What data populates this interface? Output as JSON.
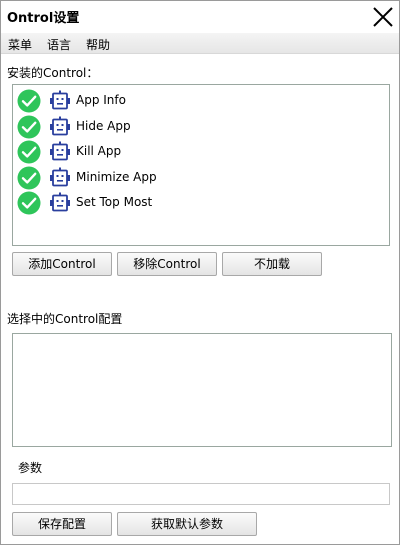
{
  "window": {
    "title": "Ontrol设置"
  },
  "menubar": {
    "items": [
      "菜单",
      "语言",
      "帮助"
    ]
  },
  "installed": {
    "label": "安装的Control：",
    "items": [
      {
        "label": "App Info",
        "checked": true,
        "icon": "robot-icon"
      },
      {
        "label": "Hide App",
        "checked": true,
        "icon": "robot-icon"
      },
      {
        "label": "Kill App",
        "checked": true,
        "icon": "robot-icon"
      },
      {
        "label": "Minimize App",
        "checked": true,
        "icon": "robot-icon"
      },
      {
        "label": "Set Top Most",
        "checked": true,
        "icon": "robot-icon"
      }
    ]
  },
  "actions": {
    "add_label": "添加Control",
    "remove_label": "移除Control",
    "unload_label": "不加载"
  },
  "config": {
    "label": "选择中的Control配置",
    "value": ""
  },
  "params": {
    "label": "参数",
    "value": ""
  },
  "footer": {
    "save_label": "保存配置",
    "default_label": "获取默认参数"
  },
  "colors": {
    "check_green": "#2ec55a",
    "robot_blue": "#2a3f9e"
  }
}
